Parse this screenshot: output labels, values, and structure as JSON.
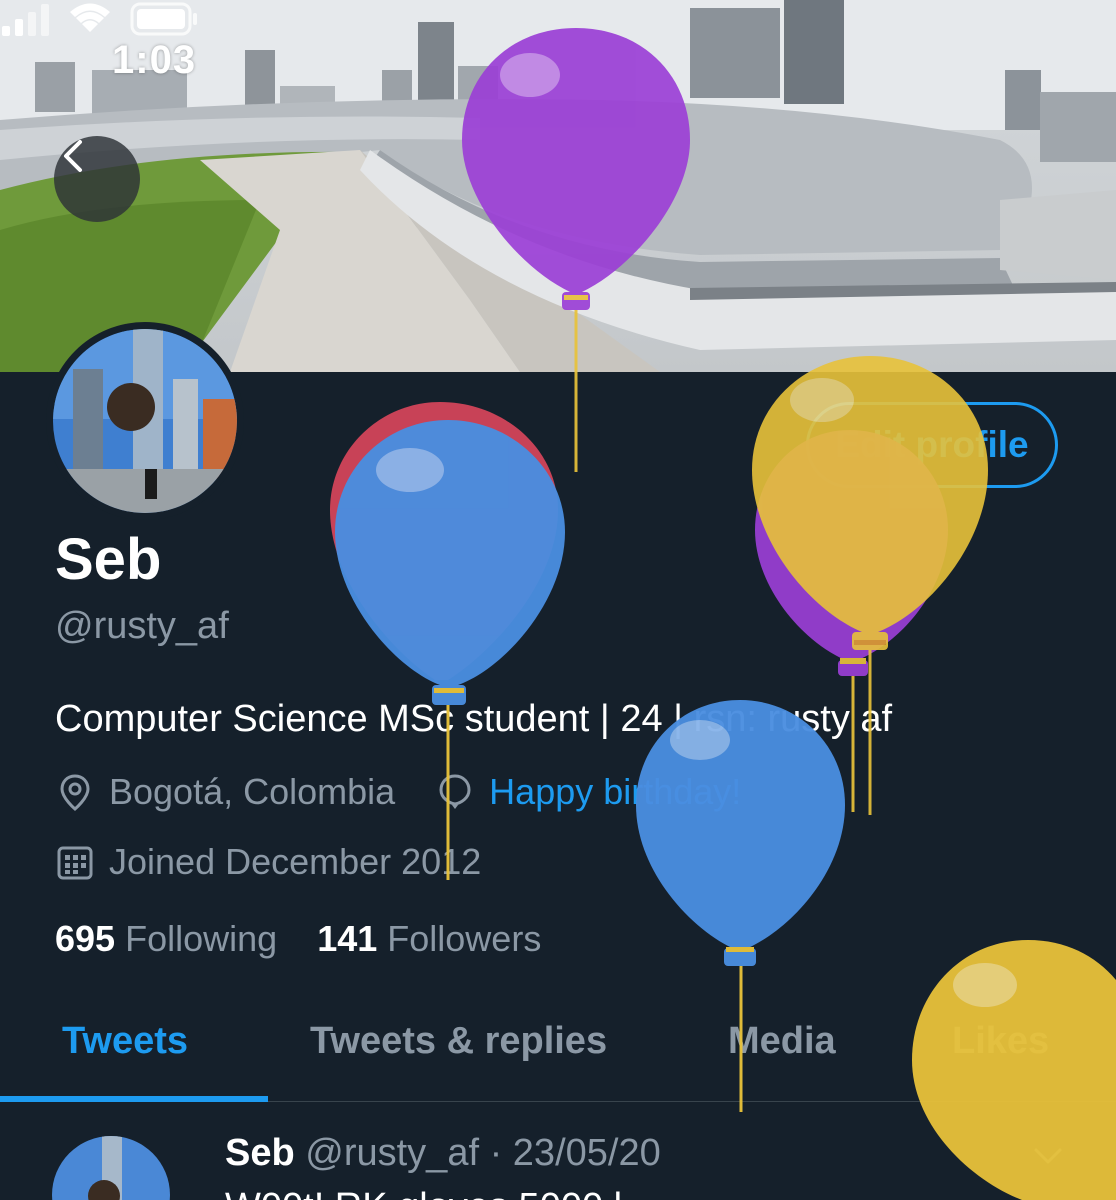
{
  "status_bar": {
    "time": "1:03",
    "icons": [
      "signal-icon",
      "wifi-icon",
      "battery-icon"
    ]
  },
  "header": {
    "back_icon": "chevron-left-icon"
  },
  "profile": {
    "edit_label": "Edit profile",
    "name": "Seb",
    "handle": "@rusty_af",
    "bio": "Computer Science MSc student | 24 | rsn: rusty af",
    "location": "Bogotá, Colombia",
    "birthday": "Happy birthday!",
    "joined": "Joined December 2012",
    "following_count": "695",
    "following_label": "Following",
    "followers_count": "141",
    "followers_label": "Followers"
  },
  "tabs": [
    {
      "label": "Tweets",
      "active": true
    },
    {
      "label": "Tweets & replies",
      "active": false
    },
    {
      "label": "Media",
      "active": false
    },
    {
      "label": "Likes",
      "active": false
    }
  ],
  "tweet": {
    "name": "Seb",
    "handle": "@rusty_af",
    "separator": "·",
    "date": "23/05/20",
    "text": "W00t! RK gloves 5000 l"
  },
  "colors": {
    "background": "#15202b",
    "accent": "#1d9bf0",
    "secondary_text": "#8b98a5",
    "balloon_purple": "#9b3fd6",
    "balloon_blue": "#4a8ee0",
    "balloon_yellow": "#e8c23a",
    "balloon_red": "#d2455a"
  }
}
